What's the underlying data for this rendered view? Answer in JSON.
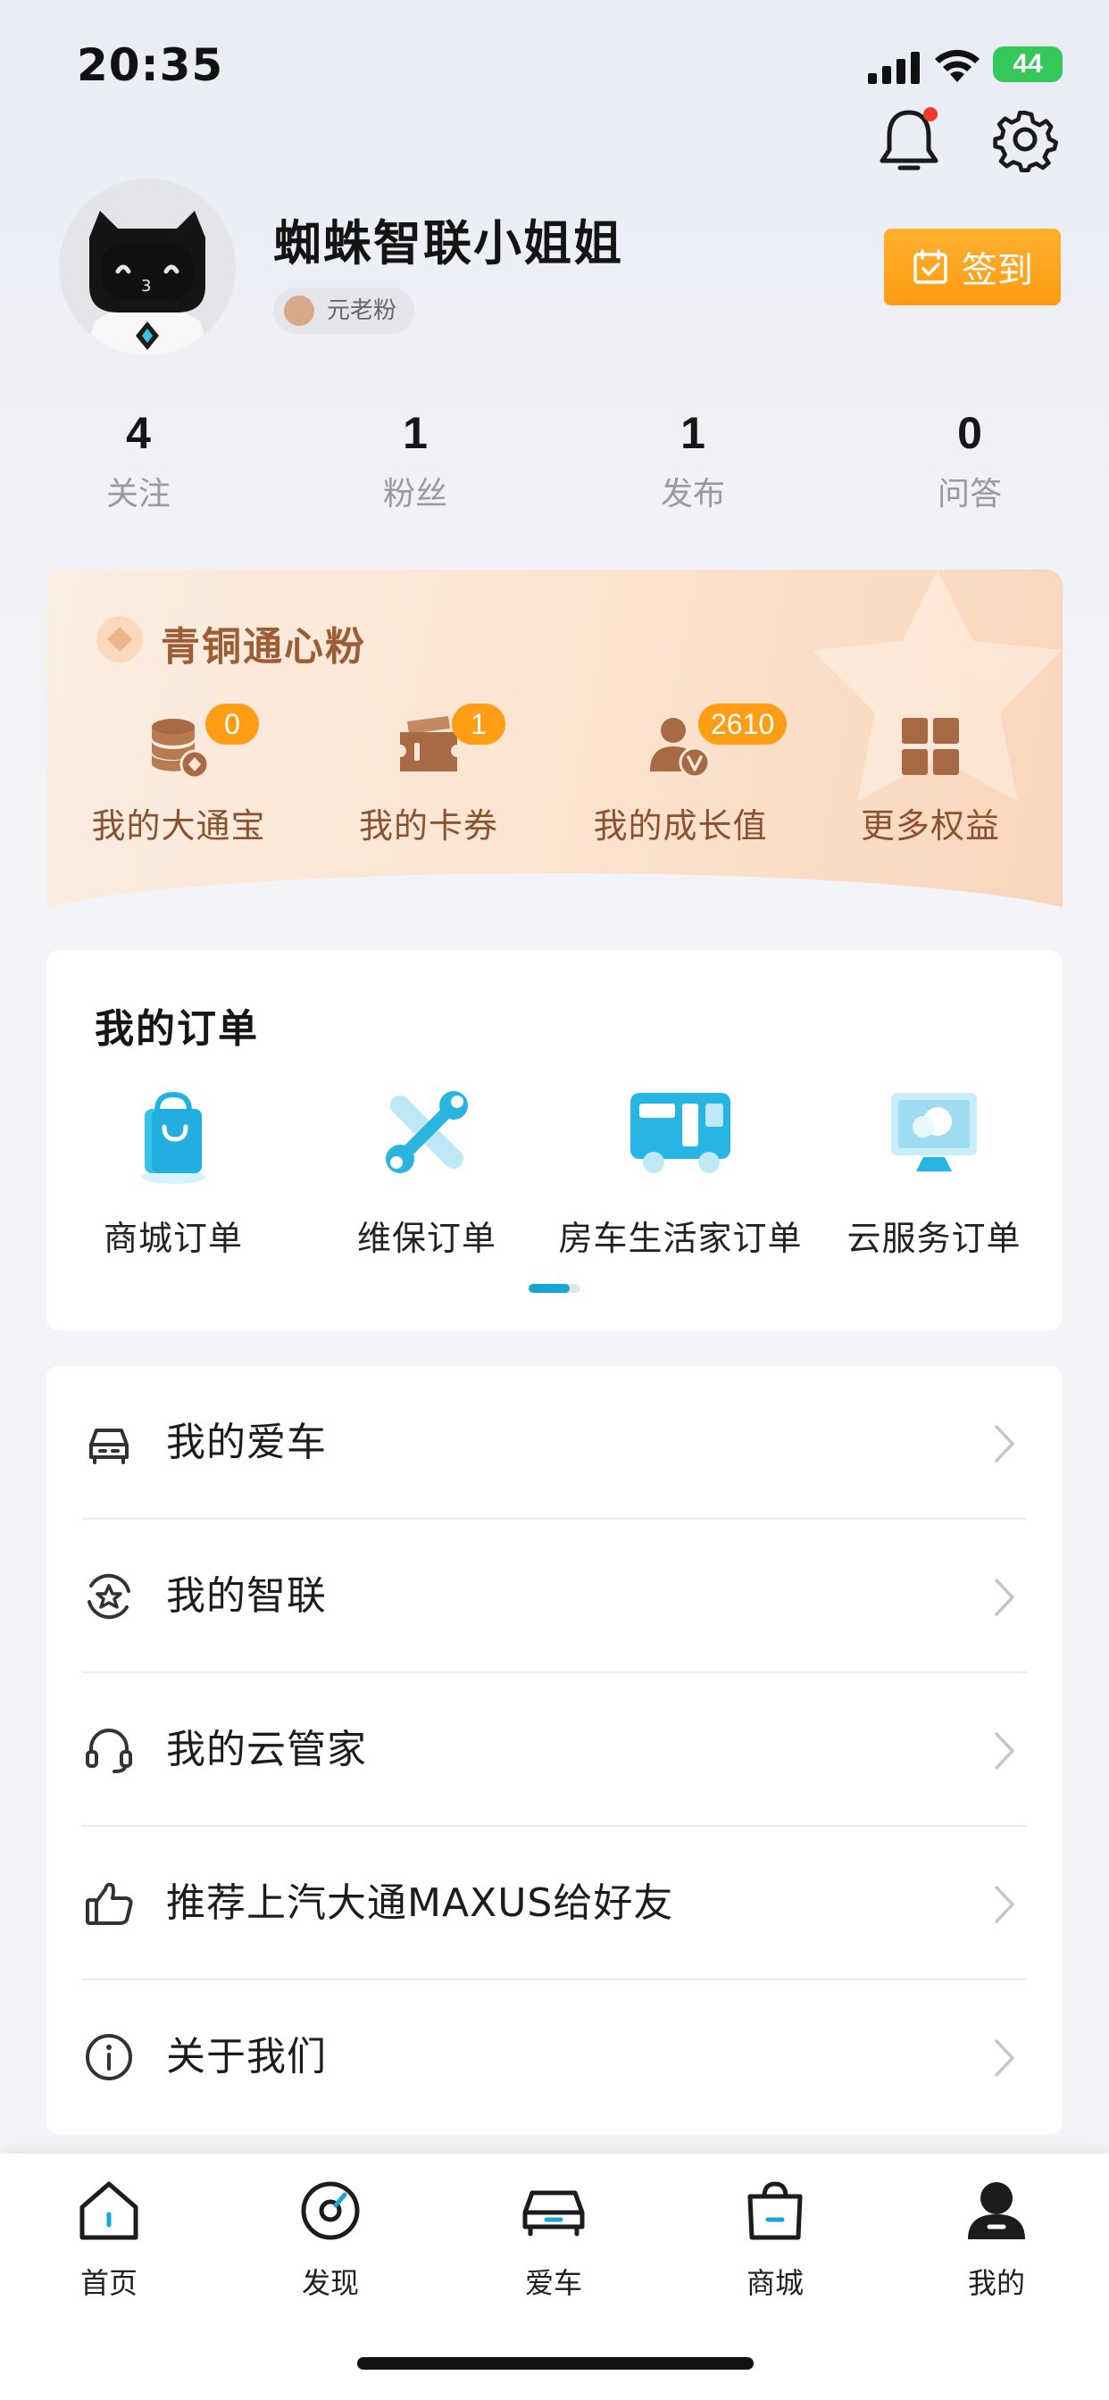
{
  "status_bar": {
    "time": "20:35",
    "battery": "44"
  },
  "profile": {
    "username": "蜘蛛智联小姐姐",
    "fan_level": "元老粉",
    "checkin_label": "签到"
  },
  "stats": [
    {
      "value": "4",
      "label": "关注"
    },
    {
      "value": "1",
      "label": "粉丝"
    },
    {
      "value": "1",
      "label": "发布"
    },
    {
      "value": "0",
      "label": "问答"
    }
  ],
  "member": {
    "tier": "青铜通心粉",
    "benefits": [
      {
        "label": "我的大通宝",
        "badge": "0",
        "icon": "coins-icon"
      },
      {
        "label": "我的卡券",
        "badge": "1",
        "icon": "coupon-icon"
      },
      {
        "label": "我的成长值",
        "badge": "2610",
        "icon": "growth-icon"
      },
      {
        "label": "更多权益",
        "icon": "grid-icon"
      }
    ]
  },
  "orders": {
    "title": "我的订单",
    "items": [
      {
        "label": "商城订单",
        "icon": "shopping-bag-icon"
      },
      {
        "label": "维保订单",
        "icon": "wrench-icon"
      },
      {
        "label": "房车生活家订单",
        "icon": "rv-icon"
      },
      {
        "label": "云服务订单",
        "icon": "cloud-service-icon"
      }
    ]
  },
  "menu": [
    {
      "label": "我的爱车",
      "icon": "car-icon"
    },
    {
      "label": "我的智联",
      "icon": "smart-link-icon"
    },
    {
      "label": "我的云管家",
      "icon": "headset-icon"
    },
    {
      "label": "推荐上汽大通MAXUS给好友",
      "icon": "thumbs-up-icon"
    },
    {
      "label": "关于我们",
      "icon": "info-icon"
    }
  ],
  "tabbar": [
    {
      "label": "首页",
      "icon": "home-icon"
    },
    {
      "label": "发现",
      "icon": "discover-icon"
    },
    {
      "label": "爱车",
      "icon": "car-icon"
    },
    {
      "label": "商城",
      "icon": "shop-icon"
    },
    {
      "label": "我的",
      "icon": "profile-icon",
      "active": true
    }
  ],
  "colors": {
    "accent_orange": "#ff9d14",
    "accent_blue": "#15a6d3",
    "member_text": "#9b5e34"
  }
}
